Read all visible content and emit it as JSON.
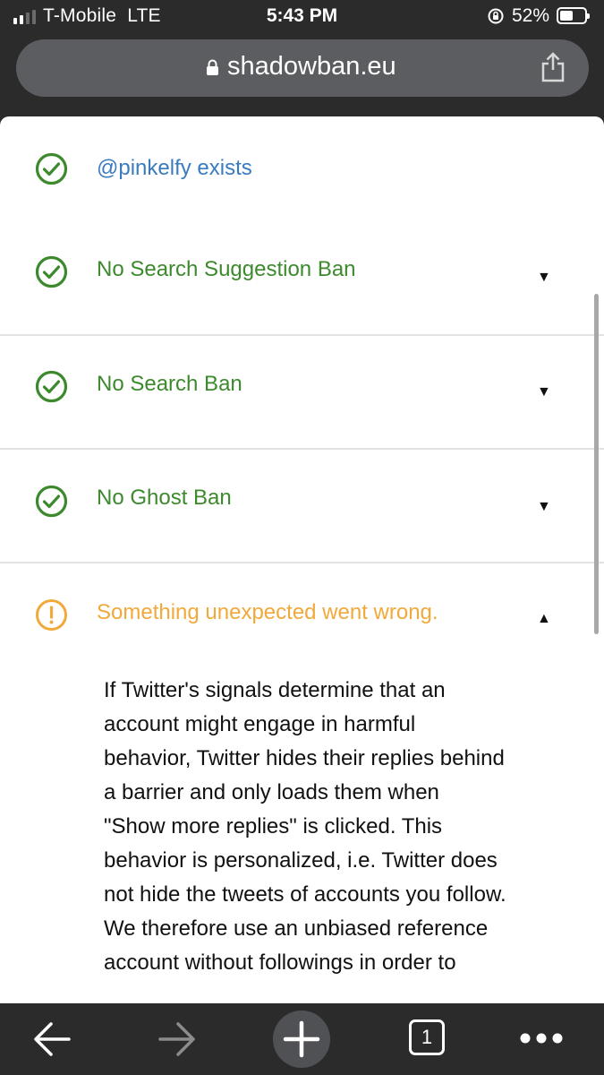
{
  "status_bar": {
    "carrier": "T-Mobile",
    "network": "LTE",
    "time": "5:43 PM",
    "battery_percent": "52%",
    "battery_level": 0.52
  },
  "browser": {
    "url": "shadowban.eu",
    "tab_count": "1"
  },
  "results": [
    {
      "label": "@pinkelfy exists",
      "status": "ok",
      "icon": "check-circle-icon",
      "color": "#3a7bbf"
    },
    {
      "label": "No Search Suggestion Ban",
      "status": "ok",
      "icon": "check-circle-icon",
      "color": "#3d8a2e",
      "caret": "▼"
    },
    {
      "label": "No Search Ban",
      "status": "ok",
      "icon": "check-circle-icon",
      "color": "#3d8a2e",
      "caret": "▼"
    },
    {
      "label": "No Ghost Ban",
      "status": "ok",
      "icon": "check-circle-icon",
      "color": "#3d8a2e",
      "caret": "▼"
    },
    {
      "label": "Something unexpected went wrong.",
      "status": "warning",
      "icon": "warning-circle-icon",
      "color": "#f0a93a",
      "caret": "▲"
    }
  ],
  "description": "If Twitter's signals determine that an account might engage in harmful behavior, Twitter hides their replies behind a barrier and only loads them when \"Show more replies\" is clicked. This behavior is personalized, i.e. Twitter does not hide the tweets of accounts you follow. We therefore use an unbiased reference account without followings in order to",
  "colors": {
    "success": "#3d8a2e",
    "link": "#3a7bbf",
    "warning": "#f0a93a",
    "chrome": "#2b2b2c"
  }
}
